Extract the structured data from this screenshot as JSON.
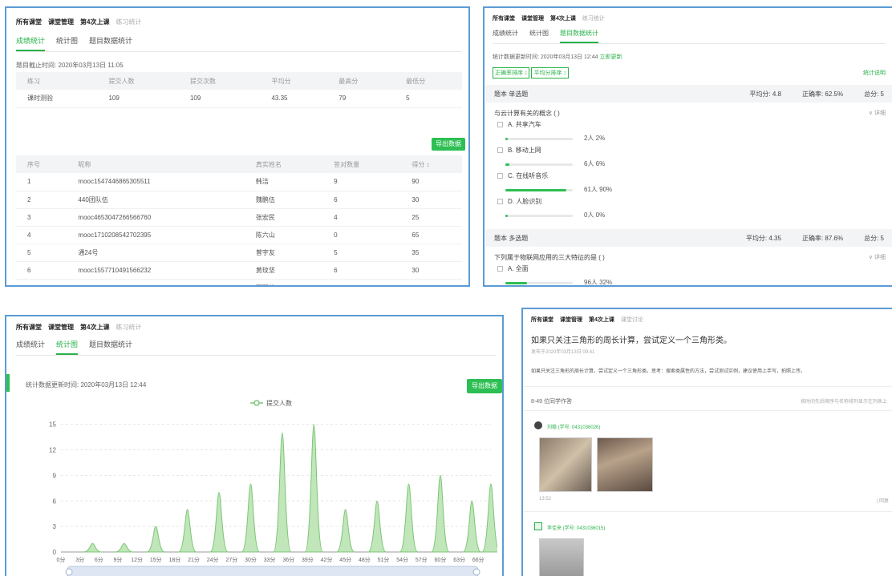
{
  "p1": {
    "crumbs": [
      "所有课堂",
      "课堂管理",
      "第4次上课",
      "练习统计"
    ],
    "tabs": [
      "成绩统计",
      "统计图",
      "题目数据统计"
    ],
    "deadline": "题目截止时间: 2020年03月13日 11:05",
    "summary_headers": [
      "练习",
      "提交人数",
      "提交次数",
      "平均分",
      "最高分",
      "最低分"
    ],
    "summary_row": [
      "课时测验",
      "109",
      "109",
      "43.35",
      "79",
      "5"
    ],
    "export_label": "导出数据",
    "list_headers": [
      "序号",
      "昵称",
      "真实姓名",
      "答对数量",
      "得分 ↕"
    ],
    "rows": [
      [
        "1",
        "mooc1547446865305511",
        "韩洁",
        "9",
        "90"
      ],
      [
        "2",
        "440团队伍",
        "魏鹏伍",
        "6",
        "30"
      ],
      [
        "3",
        "mooc4653047266566760",
        "张宏民",
        "4",
        "25"
      ],
      [
        "4",
        "mooc1710208542702395",
        "陈六山",
        "0",
        "65"
      ],
      [
        "5",
        "通24号",
        "曾宇友",
        "5",
        "35"
      ],
      [
        "6",
        "mooc1557710491566232",
        "黄玟坚",
        "6",
        "30"
      ],
      [
        "7",
        "mooc1494002438553130",
        "覃丽华",
        "7",
        "45"
      ]
    ]
  },
  "p2": {
    "crumbs": [
      "所有课堂",
      "课堂管理",
      "第4次上课",
      "练习统计"
    ],
    "tabs": [
      "成绩统计",
      "统计图",
      "题目数据统计"
    ],
    "update_time": "统计数据更新时间: 2020年03月13日 12:44",
    "update_link": "立即更新",
    "sort1": "正确率排序 ↕",
    "sort2": "平均分排序 ↕",
    "right_link": "统计说明",
    "q1": {
      "type": "题本 单选题",
      "avg": "平均分: 4.8",
      "rate": "正确率: 62.5%",
      "total": "总分: 5",
      "title": "与云计算有关的概念 ( )",
      "expand": "∨ 详细",
      "options": [
        {
          "label": "A. 共享汽车",
          "stat": "2人   2%",
          "pct": 0.02
        },
        {
          "label": "B. 移动上网",
          "stat": "6人   6%",
          "pct": 0.06
        },
        {
          "label": "C. 在线听音乐",
          "stat": "61人   90%",
          "pct": 0.9
        },
        {
          "label": "D. 人脸识别",
          "stat": "0人   0%",
          "pct": 0.0
        }
      ]
    },
    "q2": {
      "type": "题本 多选题",
      "avg": "平均分: 4.35",
      "rate": "正确率: 87.6%",
      "total": "总分: 5",
      "title": "下列属于物联网应用的三大特征的是 ( )",
      "expand": "∨ 详细",
      "options": [
        {
          "label": "A. 全面",
          "stat": "96人   32%",
          "pct": 0.32
        }
      ]
    }
  },
  "p3": {
    "crumbs": [
      "所有课堂",
      "课堂管理",
      "第4次上课",
      "练习统计"
    ],
    "tabs": [
      "成绩统计",
      "统计图",
      "题目数据统计"
    ],
    "update_time": "统计数据更新时间: 2020年03月13日 12:44",
    "export_label": "导出数据",
    "legend": "提交人数",
    "series_color": "#7cc576"
  },
  "chart_data": {
    "type": "area",
    "legend": "提交人数",
    "x": [
      "0分",
      "1分",
      "2分",
      "3分",
      "4分",
      "5分",
      "6分",
      "7分",
      "8分",
      "9分",
      "10分",
      "11分",
      "12分",
      "13分",
      "14分",
      "15分",
      "16分",
      "17分",
      "18分",
      "19分",
      "20分",
      "21分",
      "22分",
      "23分",
      "24分",
      "25分",
      "26分",
      "27分",
      "28分",
      "29分",
      "30分",
      "31分",
      "32分",
      "33分",
      "34分",
      "35分",
      "36分",
      "37分",
      "38分",
      "39分",
      "40分",
      "41分",
      "42分",
      "43分",
      "44分",
      "45分",
      "46分",
      "47分",
      "48分",
      "49分",
      "50分",
      "51分",
      "52分",
      "53分",
      "54分",
      "55分",
      "56分",
      "57分",
      "58分",
      "59分",
      "60分",
      "61分",
      "62分",
      "63分",
      "64分",
      "65分",
      "66分",
      "67分",
      "68分"
    ],
    "x_tick_labels": [
      "0分",
      "3分",
      "6分",
      "9分",
      "12分",
      "15分",
      "18分",
      "21分",
      "24分",
      "27分",
      "30分",
      "33分",
      "36分",
      "39分",
      "42分",
      "45分",
      "48分",
      "51分",
      "54分",
      "57分",
      "60分",
      "63分",
      "66分"
    ],
    "peaks": [
      {
        "x": "5分",
        "y": 1
      },
      {
        "x": "10分",
        "y": 1
      },
      {
        "x": "15分",
        "y": 3
      },
      {
        "x": "20分",
        "y": 5
      },
      {
        "x": "25分",
        "y": 7
      },
      {
        "x": "30分",
        "y": 8
      },
      {
        "x": "35分",
        "y": 14
      },
      {
        "x": "40分",
        "y": 15
      },
      {
        "x": "45分",
        "y": 5
      },
      {
        "x": "50分",
        "y": 6
      },
      {
        "x": "55分",
        "y": 8
      },
      {
        "x": "60分",
        "y": 9
      },
      {
        "x": "65分",
        "y": 6
      },
      {
        "x": "70分",
        "y": 8
      }
    ],
    "y_ticks": [
      0,
      3,
      6,
      9,
      12,
      15
    ],
    "ylim": [
      0,
      16
    ]
  },
  "p4": {
    "crumbs": [
      "所有课堂",
      "课堂管理",
      "第4次上课",
      "课堂讨论"
    ],
    "title": "如果只关注三角形的周长计算，尝试定义一个三角形类。",
    "time": "发布于2020年03月13日 09:41",
    "desc": "如果只关注三角形的周长计算，尝试定义一个三角形类。思考：搜索类属性的方法，尝试测试实例，建议使用上手写，拍照上传。",
    "reply_count": "8-49 位同学作答",
    "reply_right": "按时间先后顺序与名称排列显示在列表上",
    "user1": "刘稳  (学号: 0431036026)",
    "time1": "13:52",
    "reply_short": "| 回复",
    "user2": "李佳来  (学号: 0431036015)"
  }
}
